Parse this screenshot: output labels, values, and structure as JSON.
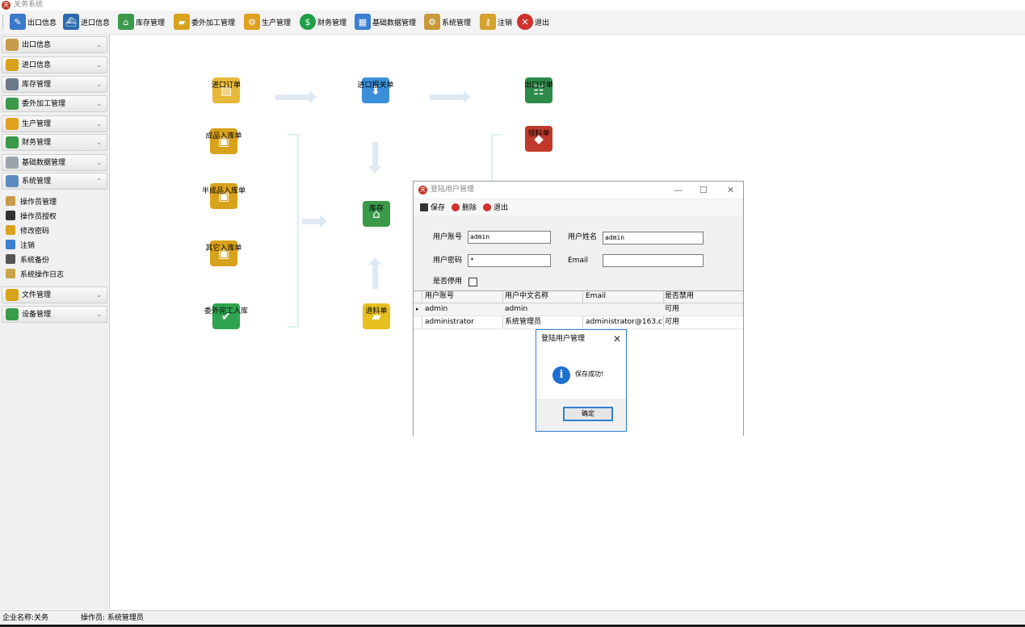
{
  "window": {
    "title": "关务系统",
    "logo_text": "关"
  },
  "toolbar": [
    {
      "label": "出口信息",
      "icon": "pencil-icon",
      "color": "#3a78c9"
    },
    {
      "label": "进口信息",
      "icon": "ship-icon",
      "color": "#2b6cb0"
    },
    {
      "label": "库存管理",
      "icon": "house-icon",
      "color": "#3a9a4a"
    },
    {
      "label": "委外加工管理",
      "icon": "folder-icon",
      "color": "#d8a21a"
    },
    {
      "label": "生产管理",
      "icon": "gear-icon",
      "color": "#e0a020"
    },
    {
      "label": "财务管理",
      "icon": "dollar-icon",
      "color": "#1f9e45"
    },
    {
      "label": "基础数据管理",
      "icon": "table-icon",
      "color": "#3b7fd0"
    },
    {
      "label": "系统管理",
      "icon": "gears-icon",
      "color": "#c79a3a"
    },
    {
      "label": "注销",
      "icon": "key-icon",
      "color": "#d6a12c"
    },
    {
      "label": "退出",
      "icon": "close-icon",
      "color": "#d0312d"
    }
  ],
  "sidebar": {
    "groups": [
      {
        "label": "出口信息",
        "icon": "diamond-icon",
        "color": "#c99a4a",
        "chevron": "⌄"
      },
      {
        "label": "进口信息",
        "icon": "box-icon",
        "color": "#d8a21a",
        "chevron": "⌄"
      },
      {
        "label": "库存管理",
        "icon": "warehouse-icon",
        "color": "#6a7a8a",
        "chevron": "⌄"
      },
      {
        "label": "委外加工管理",
        "icon": "folder-icon",
        "color": "#3a9a4a",
        "chevron": "⌄"
      },
      {
        "label": "生产管理",
        "icon": "gear-icon",
        "color": "#e0a020",
        "chevron": "⌄"
      },
      {
        "label": "财务管理",
        "icon": "money-icon",
        "color": "#3a9a4a",
        "chevron": "⌄"
      },
      {
        "label": "基础数据管理",
        "icon": "ruler-icon",
        "color": "#9aa4ad",
        "chevron": "⌄"
      },
      {
        "label": "系统管理",
        "icon": "window-icon",
        "color": "#5a8ac0",
        "chevron": "⌃"
      }
    ],
    "sub_items": [
      {
        "label": "操作员管理",
        "icon": "users-icon",
        "color": "#c99a4a"
      },
      {
        "label": "操作员授权",
        "icon": "user-key-icon",
        "color": "#333333"
      },
      {
        "label": "修改密码",
        "icon": "lock-icon",
        "color": "#d8a21a"
      },
      {
        "label": "注销",
        "icon": "logout-icon",
        "color": "#3b7fd0"
      },
      {
        "label": "系统备份",
        "icon": "backup-icon",
        "color": "#555555"
      },
      {
        "label": "系统操作日志",
        "icon": "log-icon",
        "color": "#c9a64a"
      }
    ],
    "more_groups": [
      {
        "label": "文件管理",
        "icon": "file-icon",
        "color": "#d8a21a",
        "chevron": "⌄"
      },
      {
        "label": "设备管理",
        "icon": "device-icon",
        "color": "#3a9a4a",
        "chevron": "⌄"
      }
    ]
  },
  "flow": [
    {
      "label": "进口订单",
      "icon": "clipboard-icon",
      "color": "#e8b83a"
    },
    {
      "label": "进口报关单",
      "icon": "download-folder-icon",
      "color": "#3b8fd8"
    },
    {
      "label": "出口订单",
      "icon": "contact-card-icon",
      "color": "#2e8a4a"
    },
    {
      "label": "领料单",
      "icon": "cube-icon",
      "color": "#c0392b"
    },
    {
      "label": "成品入库单",
      "icon": "boxes-icon",
      "color": "#d8a21a"
    },
    {
      "label": "半成品入库单",
      "icon": "boxes-icon",
      "color": "#d8a21a"
    },
    {
      "label": "库存",
      "icon": "house-icon",
      "color": "#3a9a4a"
    },
    {
      "label": "其它入库单",
      "icon": "boxes-icon",
      "color": "#d8a21a"
    },
    {
      "label": "委外完工入库",
      "icon": "check-icon",
      "color": "#2ea44f"
    },
    {
      "label": "退料单",
      "icon": "open-folder-icon",
      "color": "#e8c020"
    }
  ],
  "dialog": {
    "title": "登陆用户管理",
    "buttons": {
      "minimize": "—",
      "maximize": "☐",
      "close": "✕"
    },
    "toolbar": [
      {
        "label": "保存",
        "icon": "save-icon",
        "color": "#333333"
      },
      {
        "label": "删除",
        "icon": "delete-icon",
        "color": "#d0312d"
      },
      {
        "label": "退出",
        "icon": "exit-icon",
        "color": "#d0312d"
      }
    ],
    "form": {
      "account_label": "用户账号",
      "account_value": "admin",
      "name_label": "用户姓名",
      "name_value": "admin",
      "password_label": "用户密码",
      "password_value": "*",
      "email_label": "Email",
      "email_value": "",
      "disabled_label": "是否停用"
    },
    "grid": {
      "columns": [
        "用户账号",
        "用户中文名称",
        "Email",
        "是否禁用"
      ],
      "rows": [
        [
          "admin",
          "admin",
          "",
          "可用"
        ],
        [
          "administrator",
          "系统管理员",
          "administrator@163.c...",
          "可用"
        ]
      ],
      "current_row_marker": "▸"
    }
  },
  "msgbox": {
    "title": "登陆用户管理",
    "close": "✕",
    "info_glyph": "i",
    "message": "保存成功!",
    "ok_label": "确定"
  },
  "status": {
    "company": "企业名称:关务",
    "operator": "操作员: 系统管理员"
  }
}
